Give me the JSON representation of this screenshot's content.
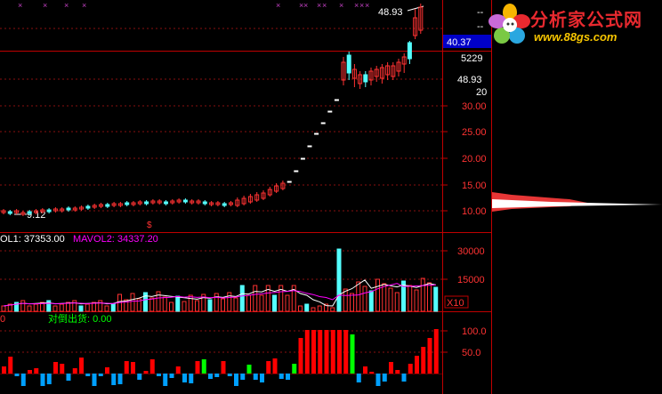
{
  "logo": {
    "name": "分析家公式网",
    "url": "www.88gs.com"
  },
  "price_axis": {
    "upper_labels": [
      "48.93",
      "--",
      "--"
    ],
    "current": "40.37",
    "vol_label": "5229",
    "price_label": "48.93",
    "count_label": "20",
    "ticks": [
      "30.00",
      "25.00",
      "20.00",
      "15.00",
      "10.00"
    ]
  },
  "annotations": {
    "high": "48.93",
    "low": "9.12",
    "marker": "$"
  },
  "volume_panel": {
    "legend": [
      {
        "label": "OL1: 37353.00",
        "color": "#ffffff"
      },
      {
        "label": "MAVOL2: 34337.20",
        "color": "#ff00ff"
      }
    ],
    "ticks": [
      "30000",
      "15000"
    ],
    "unit": "X10"
  },
  "indicator_panel": {
    "legend_cut": "0",
    "legend": "对倒出货: 0.00",
    "ticks": [
      "100.0",
      "50.0"
    ]
  },
  "colors": {
    "up": "#ff3232",
    "down": "#54ffff",
    "grid": "#8a1010",
    "border": "#c00000",
    "ma1": "#ffffff",
    "ma2": "#ff00ff",
    "ind_green": "#00ff00",
    "ind_blue": "#00a0ff"
  }
}
